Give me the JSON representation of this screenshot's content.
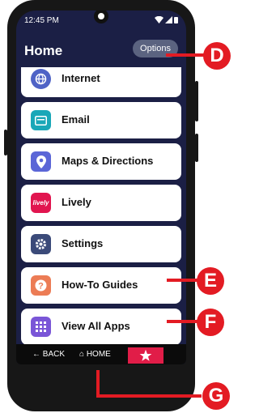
{
  "status_bar": {
    "time": "12:45 PM"
  },
  "header": {
    "title": "Home",
    "options_label": "Options"
  },
  "apps": [
    {
      "label": "Internet",
      "icon": "globe-icon",
      "color": "#4f63c6"
    },
    {
      "label": "Email",
      "icon": "email-icon",
      "color": "#19a7b8"
    },
    {
      "label": "Maps & Directions",
      "icon": "map-pin-icon",
      "color": "#5b66d7"
    },
    {
      "label": "Lively",
      "icon": "lively-logo",
      "color": "#e1154f"
    },
    {
      "label": "Settings",
      "icon": "gear-icon",
      "color": "#3b4a79"
    },
    {
      "label": "How-To Guides",
      "icon": "question-icon",
      "color": "#ec7c55"
    },
    {
      "label": "View All Apps",
      "icon": "grid-icon",
      "color": "#7a56d7"
    }
  ],
  "navbar": {
    "back_label": "BACK",
    "home_label": "HOME"
  },
  "callouts": {
    "d": "D",
    "e": "E",
    "f": "F",
    "g": "G"
  }
}
